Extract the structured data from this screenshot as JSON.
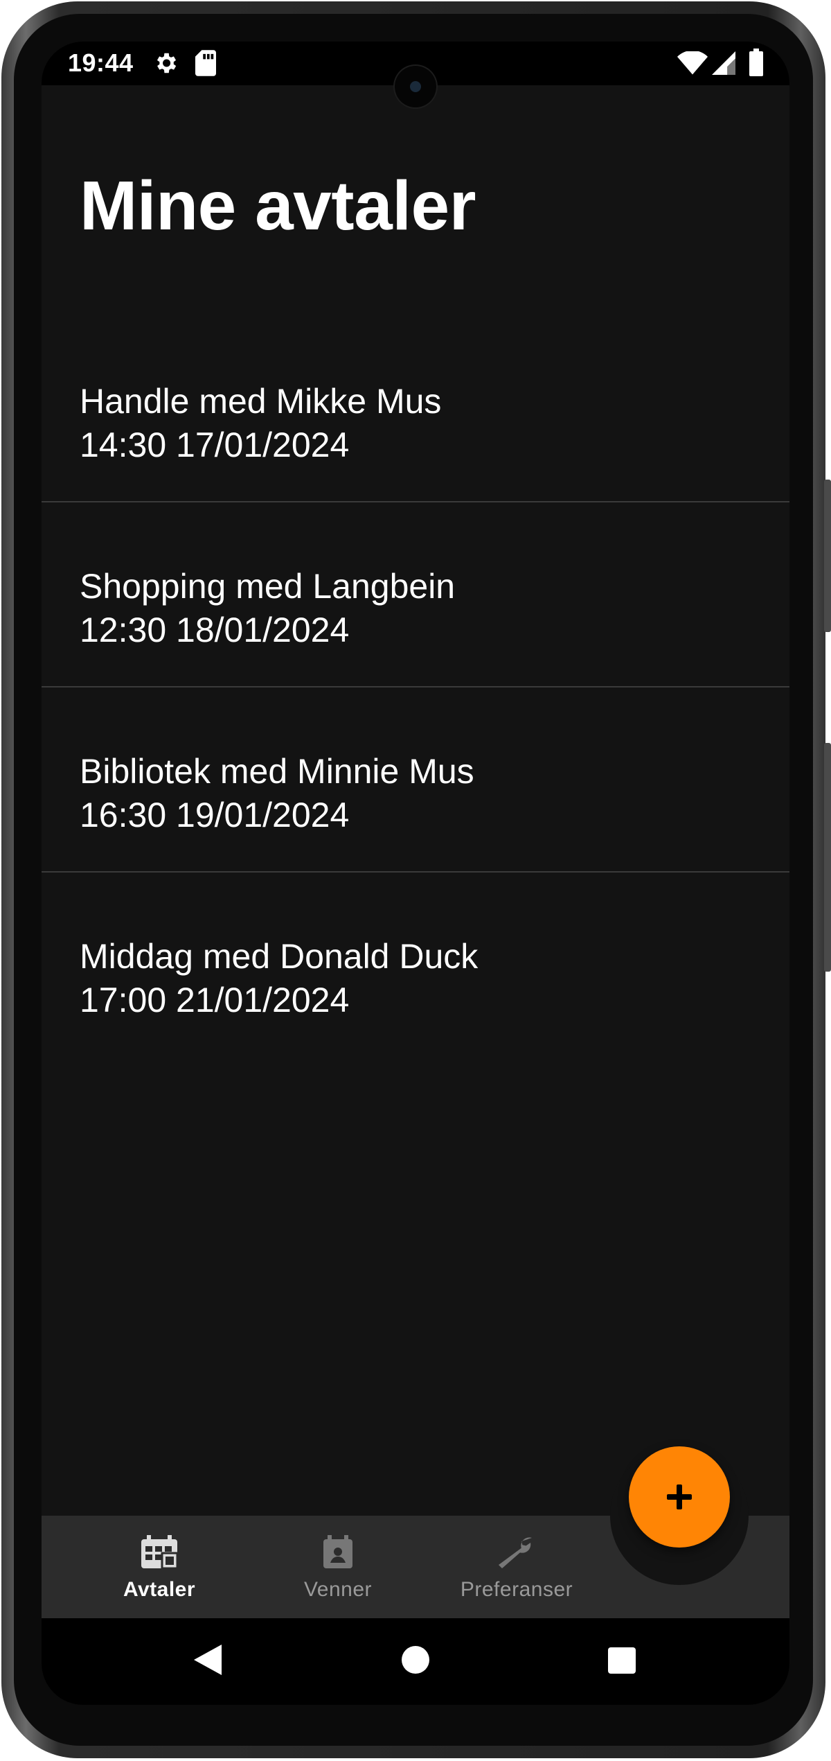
{
  "status_bar": {
    "time": "19:44",
    "icons": [
      "gear-icon",
      "sd-card-icon",
      "wifi-icon",
      "signal-icon",
      "battery-icon"
    ]
  },
  "page": {
    "title": "Mine avtaler"
  },
  "appointments": [
    {
      "title": "Handle med Mikke Mus",
      "time": "14:30 17/01/2024"
    },
    {
      "title": "Shopping med Langbein",
      "time": "12:30 18/01/2024"
    },
    {
      "title": "Bibliotek med Minnie Mus",
      "time": "16:30 19/01/2024"
    },
    {
      "title": "Middag med Donald Duck",
      "time": "17:00 21/01/2024"
    }
  ],
  "fab": {
    "icon": "plus-icon",
    "color": "#ff8505"
  },
  "bottom_nav": {
    "items": [
      {
        "label": "Avtaler",
        "icon": "calendar-grid-icon",
        "active": true
      },
      {
        "label": "Venner",
        "icon": "calendar-person-icon",
        "active": false
      },
      {
        "label": "Preferanser",
        "icon": "wrench-icon",
        "active": false
      }
    ]
  },
  "system_nav": {
    "icons": [
      "back-icon",
      "home-icon",
      "recents-icon"
    ]
  },
  "colors": {
    "background": "#131313",
    "accent": "#ff8505",
    "nav_background": "#2c2c2c",
    "divider": "#3a3a3a"
  }
}
